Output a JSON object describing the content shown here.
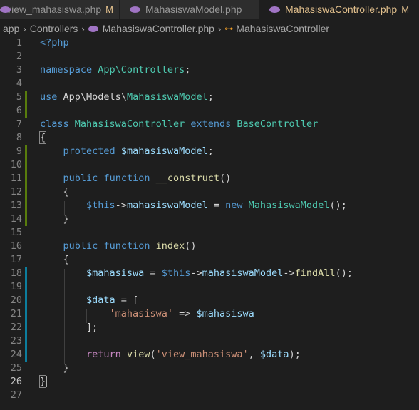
{
  "tabs": [
    {
      "label": "view_mahasiswa.php",
      "badge": "M",
      "active": false
    },
    {
      "label": "MahasiswaModel.php",
      "badge": "",
      "active": false
    },
    {
      "label": "MahasiswaController.php",
      "badge": "M",
      "active": true
    }
  ],
  "breadcrumb": {
    "items": [
      "app",
      "Controllers",
      "MahasiswaController.php",
      "MahasiswaController"
    ]
  },
  "lines": [
    "1",
    "2",
    "3",
    "4",
    "5",
    "6",
    "7",
    "8",
    "9",
    "10",
    "11",
    "12",
    "13",
    "14",
    "15",
    "16",
    "17",
    "18",
    "19",
    "20",
    "21",
    "22",
    "23",
    "24",
    "25",
    "26",
    "27"
  ],
  "code": {
    "l1": "<?php",
    "l3_kw": "namespace",
    "l3_ns": "App\\Controllers",
    "l3_end": ";",
    "l5_kw": "use",
    "l5_ns": "App\\Models\\",
    "l5_cls": "MahasiswaModel",
    "l5_end": ";",
    "l7_kw1": "class",
    "l7_cls": "MahasiswaController",
    "l7_kw2": "extends",
    "l7_base": "BaseController",
    "l8": "{",
    "l9_kw": "protected",
    "l9_var": "$mahasiswaModel",
    "l9_end": ";",
    "l11_kw1": "public",
    "l11_kw2": "function",
    "l11_fn": "__construct",
    "l11_end": "()",
    "l12": "{",
    "l13_this": "$this",
    "l13_arrow": "->",
    "l13_prop": "mahasiswaModel",
    "l13_eq": " = ",
    "l13_new": "new",
    "l13_cls": "MahasiswaModel",
    "l13_end": "();",
    "l14": "}",
    "l16_kw1": "public",
    "l16_kw2": "function",
    "l16_fn": "index",
    "l16_end": "()",
    "l17": "{",
    "l18_var": "$mahasiswa",
    "l18_eq": " = ",
    "l18_this": "$this",
    "l18_arrow": "->",
    "l18_prop": "mahasiswaModel",
    "l18_arrow2": "->",
    "l18_fn": "findAll",
    "l18_end": "();",
    "l20_var": "$data",
    "l20_rest": " = [",
    "l21_str": "'mahasiswa'",
    "l21_op": " => ",
    "l21_var": "$mahasiswa",
    "l22": "];",
    "l24_kw": "return",
    "l24_fn": "view",
    "l24_open": "(",
    "l24_str": "'view_mahasiswa'",
    "l24_comma": ", ",
    "l24_var": "$data",
    "l24_end": ");",
    "l25": "}",
    "l26": "}"
  },
  "colors": {
    "keyword": "#569cd6",
    "class": "#4ec9b0",
    "variable": "#9cdcfe",
    "function": "#dcdcaa",
    "string": "#ce9178",
    "added": "#587c0c",
    "modified": "#0c7d9d"
  }
}
